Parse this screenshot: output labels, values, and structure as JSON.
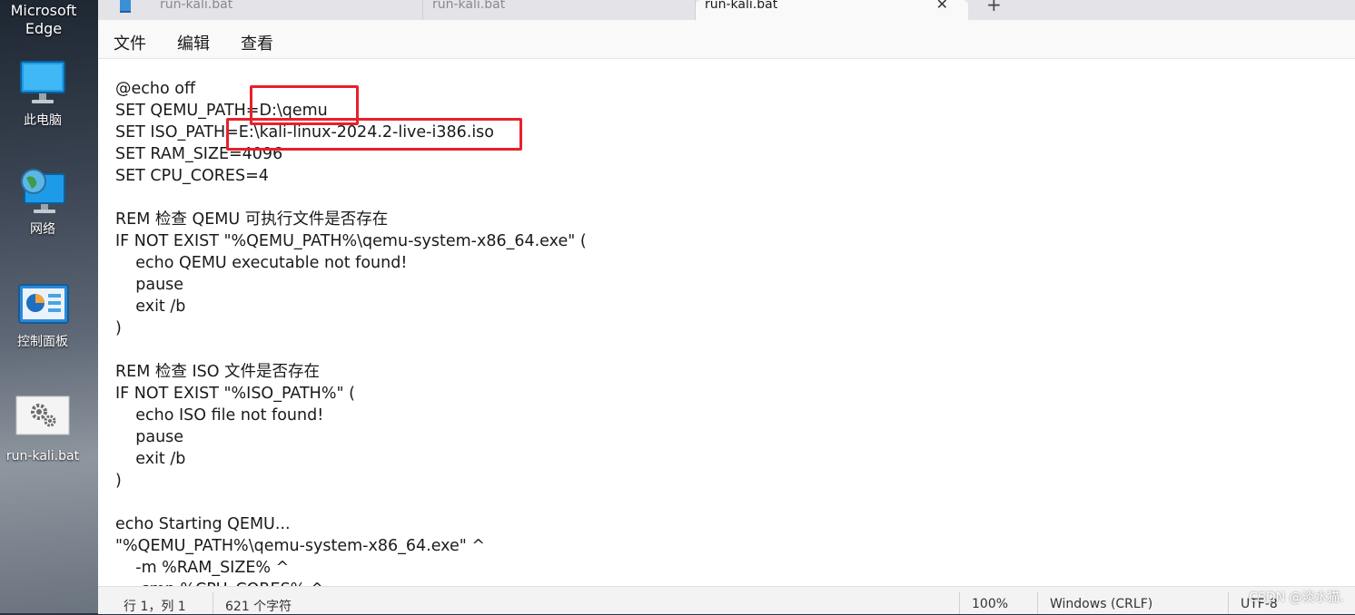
{
  "desktop": {
    "edge_label_line1": "Microsoft",
    "edge_label_line2": "Edge",
    "icons": [
      {
        "label": "此电脑",
        "icon": "computer-icon"
      },
      {
        "label": "网络",
        "icon": "network-icon"
      },
      {
        "label": "控制面板",
        "icon": "control-panel-icon"
      },
      {
        "label": "run-kali.bat",
        "icon": "batch-file-icon"
      }
    ]
  },
  "tabs": [
    {
      "label": "run-kali.bat"
    },
    {
      "label": "run-kali.bat"
    },
    {
      "label": "run-kali.bat",
      "active": true
    }
  ],
  "tab_close": "✕",
  "tab_new": "+",
  "menu": {
    "file": "文件",
    "edit": "编辑",
    "view": "查看"
  },
  "editor": {
    "text": "@echo off\nSET QEMU_PATH=D:\\qemu\nSET ISO_PATH=E:\\kali-linux-2024.2-live-i386.iso\nSET RAM_SIZE=4096\nSET CPU_CORES=4\n\nREM 检查 QEMU 可执行文件是否存在\nIF NOT EXIST \"%QEMU_PATH%\\qemu-system-x86_64.exe\" (\n    echo QEMU executable not found!\n    pause\n    exit /b\n)\n\nREM 检查 ISO 文件是否存在\nIF NOT EXIST \"%ISO_PATH%\" (\n    echo ISO file not found!\n    pause\n    exit /b\n)\n\necho Starting QEMU...\n\"%QEMU_PATH%\\qemu-system-x86_64.exe\" ^\n    -m %RAM_SIZE% ^\n    -smp %CPU_CORES% ^",
    "highlight_color": "#e8202a"
  },
  "status": {
    "position": "行 1，列 1",
    "char_count": "621 个字符",
    "zoom": "100%",
    "line_ending": "Windows (CRLF)",
    "encoding": "UTF-8"
  },
  "watermark": "CSDN @淡水猫."
}
